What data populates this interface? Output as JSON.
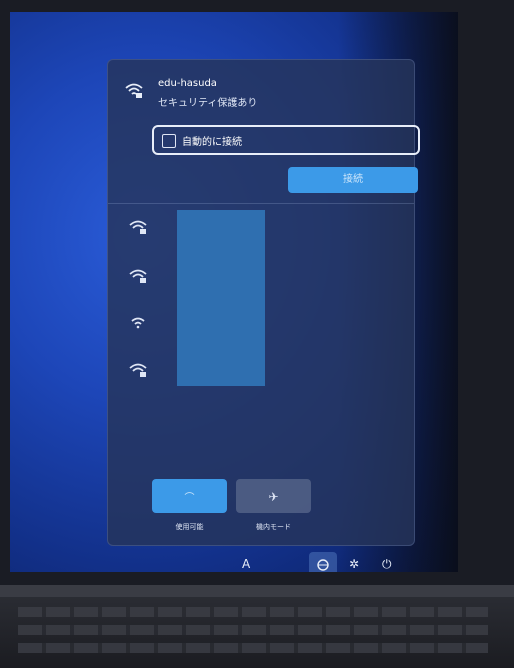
{
  "flyout": {
    "network_name": "edu-hasuda",
    "security_status": "セキュリティ保護あり",
    "auto_connect_label": "自動的に接続",
    "connect_button_label": "接続"
  },
  "networks": [
    {
      "icon": "wifi-secured-icon"
    },
    {
      "icon": "wifi-secured-icon"
    },
    {
      "icon": "wifi-icon"
    },
    {
      "icon": "wifi-secured-icon"
    }
  ],
  "quick_settings": {
    "wifi_label": "使用可能",
    "airplane_label": "機内モード"
  },
  "taskbar": {
    "ime_label": "A"
  }
}
